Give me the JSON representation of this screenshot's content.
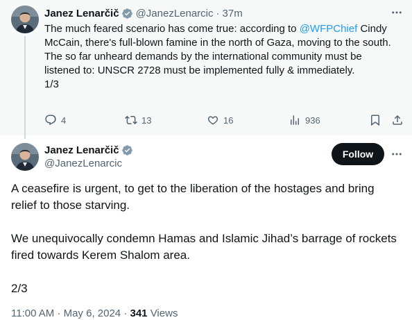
{
  "colors": {
    "link": "#1d9bf0",
    "secondary_text": "#536471",
    "primary_text": "#0f1419",
    "verified_badge": "#829aab",
    "thread_background": "#f7f9f9",
    "follow_button": "#0f1419"
  },
  "first_tweet": {
    "author_name": "Janez Lenarčič",
    "author_handle": "@JanezLenarcic",
    "separator": "·",
    "time": "37m",
    "more_icon": "more-icon",
    "text_before_mention": "The much feared scenario has come true: according to ",
    "mention": "@WFPChief",
    "text_after_mention": " Cindy McCain, there's full-blown famine in the north of Gaza, moving to the south.",
    "paragraph_2": "The so far unheard demands by the international community must be listened to: UNSCR 2728 must be implemented fully & immediately.",
    "paragraph_3": "1/3",
    "actions": {
      "replies": "4",
      "reposts": "13",
      "likes": "16",
      "views": "936"
    }
  },
  "second_tweet": {
    "author_name": "Janez Lenarčič",
    "author_handle": "@JanezLenarcic",
    "follow_label": "Follow",
    "paragraphs": [
      "A ceasefire is urgent, to get to the liberation of the hostages and bring relief to those starving.",
      "",
      "We unequivocally condemn Hamas and Islamic Jihad’s barrage of rockets fired towards Kerem Shalom area.",
      "",
      "2/3"
    ],
    "timestamp": "11:00 AM · May 6, 2024",
    "separator": " · ",
    "views_count": "341",
    "views_label": " Views"
  }
}
